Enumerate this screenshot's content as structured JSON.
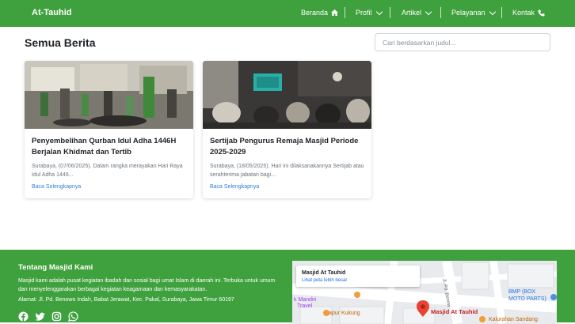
{
  "navbar": {
    "brand": "At-Tauhid",
    "items": [
      {
        "label": "Beranda",
        "icon": "home-icon"
      },
      {
        "label": "Profil",
        "icon": "chevron-down-icon"
      },
      {
        "label": "Artikel",
        "icon": "chevron-down-icon"
      },
      {
        "label": "Pelayanan",
        "icon": "chevron-down-icon"
      },
      {
        "label": "Kontak",
        "icon": "phone-icon"
      }
    ]
  },
  "main": {
    "title": "Semua Berita",
    "search": {
      "placeholder": "Cari berdasarkan judul...",
      "value": ""
    },
    "cards": [
      {
        "title": "Penyembelihan Qurban Idul Adha 1446H Berjalan Khidmat dan Tertib",
        "excerpt": "Surabaya, (07/06/2025). Dalam rangka merayakan Hari Raya Idul Adha 1446...",
        "link": "Baca Selengkapnya"
      },
      {
        "title": "Sertijab Pengurus Remaja Masjid Periode 2025-2029",
        "excerpt": "Surabaya, (18/05/2025). Hari ini dilaksanakannya Sertijab atau serahterima jabatan bagi...",
        "link": "Baca Selengkapnya"
      }
    ]
  },
  "footer": {
    "title": "Tentang Masjid Kami",
    "description": "Masjid kami adalah pusat kegiatan ibadah dan sosial bagi umat Islam di daerah ini. Terbuka untuk umum dan menyelenggarakan berbagai kegiatan keagamaan dan kemasyarakatan.",
    "address": "Alamat: Jl. Pd. Benowo Indah, Babat Jerawat, Kec. Pakal, Surabaya, Jawa Timur 60197",
    "social": [
      "facebook-icon",
      "twitter-icon",
      "instagram-icon",
      "whatsapp-icon"
    ],
    "map": {
      "place_name": "Masjid At Tauhid",
      "larger_map_link": "Lihat peta lebih besar",
      "labels": {
        "pin": "Masjid At Tauhid",
        "bmp_line1": "BMP (BOX",
        "bmp_line2": "MOTO PARTS)",
        "mandiri_line1": "k Mandiri",
        "mandiri_line2": "Travel",
        "kukung": "apur Kukung",
        "sandang": "Kalurahan Sandang",
        "street": "Jl. Pd. Benow"
      }
    }
  },
  "colors": {
    "primary": "#3fa13d",
    "link": "#2f7fe0",
    "text": "#212529",
    "muted": "#6c757d"
  }
}
